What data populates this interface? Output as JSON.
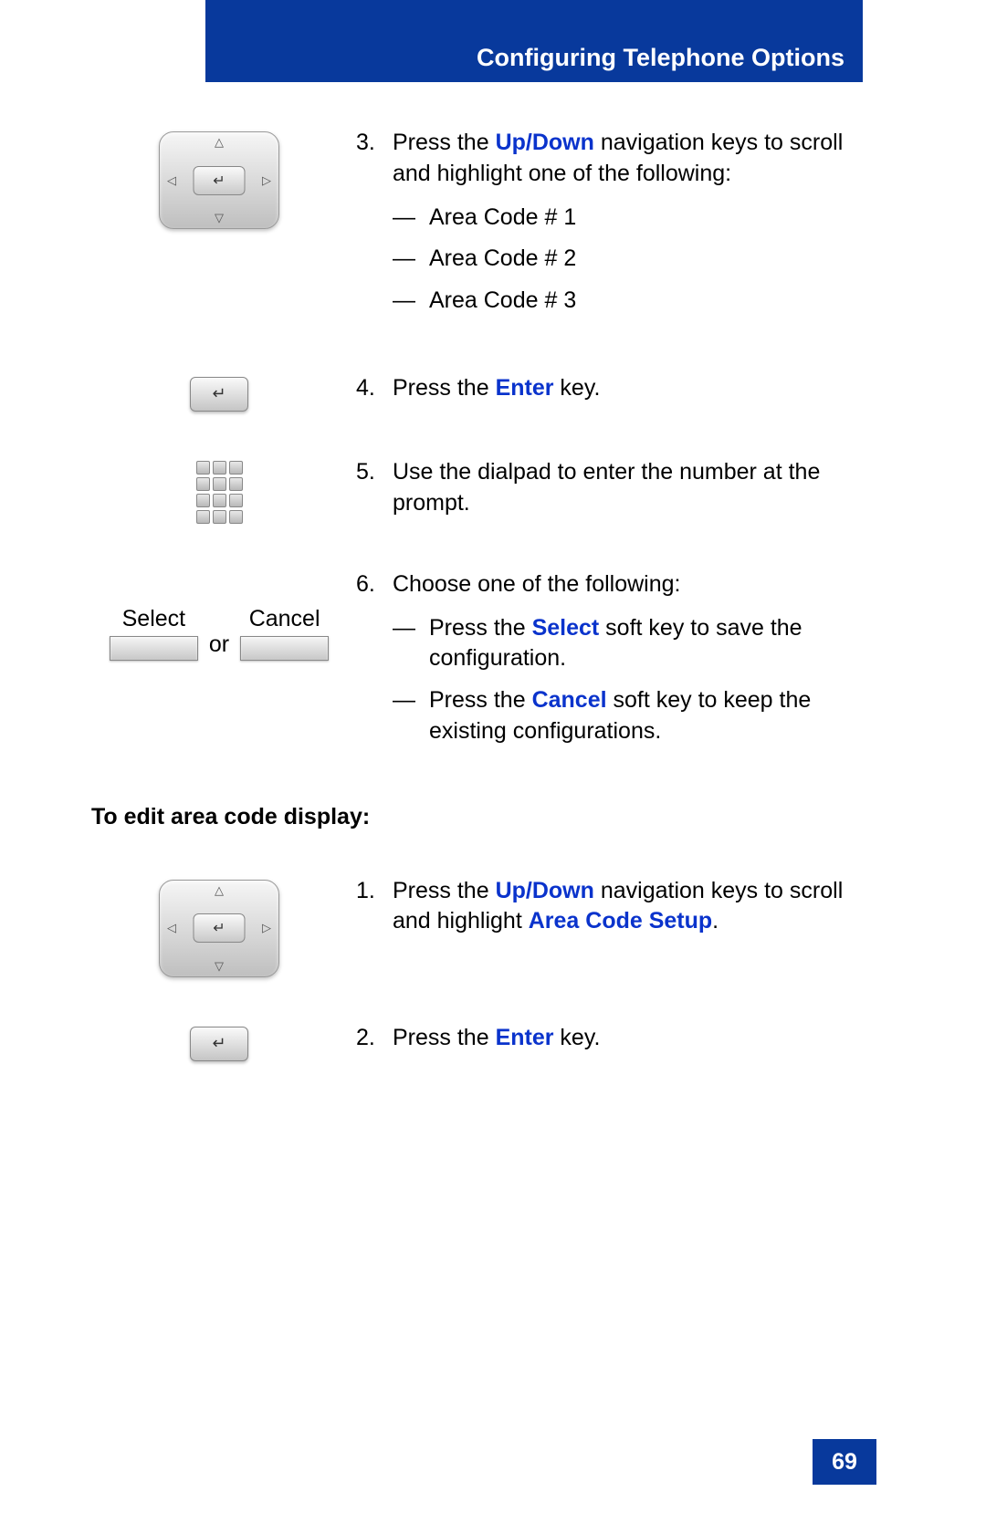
{
  "header": {
    "title": "Configuring Telephone Options"
  },
  "steps": {
    "s3": {
      "num": "3.",
      "text_prefix": "Press the ",
      "updown": "Up/Down",
      "text_suffix": " navigation keys to scroll and highlight one of the following:",
      "items": [
        "Area Code # 1",
        "Area Code # 2",
        "Area Code # 3"
      ]
    },
    "s4": {
      "num": "4.",
      "text_prefix": "Press the ",
      "enter": "Enter",
      "text_suffix": " key."
    },
    "s5": {
      "num": "5.",
      "text": "Use the dialpad to enter the number at the prompt."
    },
    "s6": {
      "num": "6.",
      "intro": "Choose one of the following:",
      "opt1_prefix": "Press the ",
      "select": "Select",
      "opt1_suffix": " soft key to save the configuration.",
      "opt2_prefix": "Press the ",
      "cancel": "Cancel",
      "opt2_suffix": " soft key to keep the existing configurations."
    }
  },
  "softkeys": {
    "select_label": "Select",
    "cancel_label": "Cancel",
    "or": "or"
  },
  "subheading": "To edit area code display:",
  "edit": {
    "s1": {
      "num": "1.",
      "text_prefix": "Press the ",
      "updown": "Up/Down",
      "text_mid": " navigation keys to scroll and highlight ",
      "areacode": "Area Code Setup",
      "text_suffix": "."
    },
    "s2": {
      "num": "2.",
      "text_prefix": "Press the ",
      "enter": "Enter",
      "text_suffix": " key."
    }
  },
  "page_number": "69",
  "dash": "—"
}
